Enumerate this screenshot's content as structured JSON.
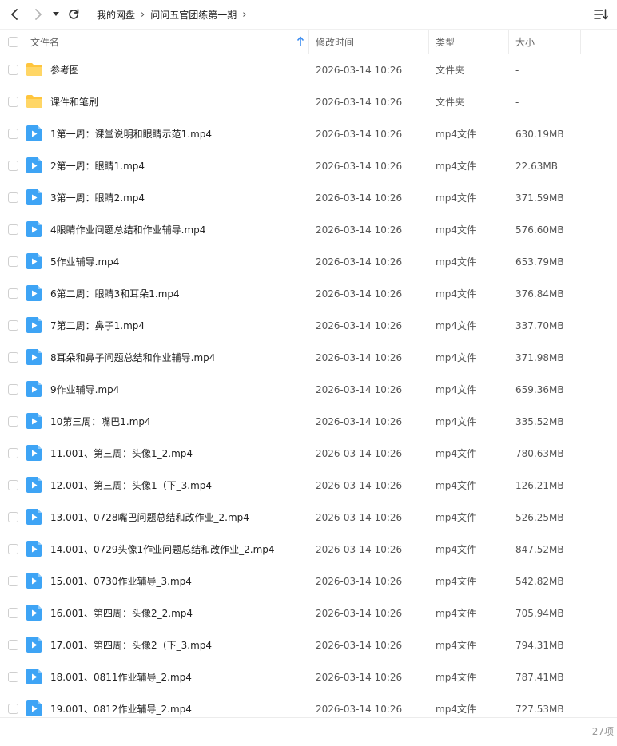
{
  "breadcrumbs": [
    "我的网盘",
    "问问五官团练第一期"
  ],
  "header": {
    "name": "文件名",
    "modified": "修改时间",
    "type": "类型",
    "size": "大小"
  },
  "footer": {
    "count": "27项"
  },
  "colors": {
    "folder": "#ffc53d",
    "video": "#3ea4f5",
    "accent": "#3b8cf0"
  },
  "files": [
    {
      "icon": "folder",
      "name": "参考图",
      "modified": "2026-03-14 10:26",
      "type": "文件夹",
      "size": "-"
    },
    {
      "icon": "folder",
      "name": "课件和笔刷",
      "modified": "2026-03-14 10:26",
      "type": "文件夹",
      "size": "-"
    },
    {
      "icon": "video",
      "name": "1第一周：课堂说明和眼睛示范1.mp4",
      "modified": "2026-03-14 10:26",
      "type": "mp4文件",
      "size": "630.19MB"
    },
    {
      "icon": "video",
      "name": "2第一周：眼睛1.mp4",
      "modified": "2026-03-14 10:26",
      "type": "mp4文件",
      "size": "22.63MB"
    },
    {
      "icon": "video",
      "name": "3第一周：眼睛2.mp4",
      "modified": "2026-03-14 10:26",
      "type": "mp4文件",
      "size": "371.59MB"
    },
    {
      "icon": "video",
      "name": "4眼睛作业问题总结和作业辅导.mp4",
      "modified": "2026-03-14 10:26",
      "type": "mp4文件",
      "size": "576.60MB"
    },
    {
      "icon": "video",
      "name": "5作业辅导.mp4",
      "modified": "2026-03-14 10:26",
      "type": "mp4文件",
      "size": "653.79MB"
    },
    {
      "icon": "video",
      "name": "6第二周：眼睛3和耳朵1.mp4",
      "modified": "2026-03-14 10:26",
      "type": "mp4文件",
      "size": "376.84MB"
    },
    {
      "icon": "video",
      "name": "7第二周：鼻子1.mp4",
      "modified": "2026-03-14 10:26",
      "type": "mp4文件",
      "size": "337.70MB"
    },
    {
      "icon": "video",
      "name": "8耳朵和鼻子问题总结和作业辅导.mp4",
      "modified": "2026-03-14 10:26",
      "type": "mp4文件",
      "size": "371.98MB"
    },
    {
      "icon": "video",
      "name": "9作业辅导.mp4",
      "modified": "2026-03-14 10:26",
      "type": "mp4文件",
      "size": "659.36MB"
    },
    {
      "icon": "video",
      "name": "10第三周：嘴巴1.mp4",
      "modified": "2026-03-14 10:26",
      "type": "mp4文件",
      "size": "335.52MB"
    },
    {
      "icon": "video",
      "name": "11.001、第三周：头像1_2.mp4",
      "modified": "2026-03-14 10:26",
      "type": "mp4文件",
      "size": "780.63MB"
    },
    {
      "icon": "video",
      "name": "12.001、第三周：头像1（下_3.mp4",
      "modified": "2026-03-14 10:26",
      "type": "mp4文件",
      "size": "126.21MB"
    },
    {
      "icon": "video",
      "name": "13.001、0728嘴巴问题总结和改作业_2.mp4",
      "modified": "2026-03-14 10:26",
      "type": "mp4文件",
      "size": "526.25MB"
    },
    {
      "icon": "video",
      "name": "14.001、0729头像1作业问题总结和改作业_2.mp4",
      "modified": "2026-03-14 10:26",
      "type": "mp4文件",
      "size": "847.52MB"
    },
    {
      "icon": "video",
      "name": "15.001、0730作业辅导_3.mp4",
      "modified": "2026-03-14 10:26",
      "type": "mp4文件",
      "size": "542.82MB"
    },
    {
      "icon": "video",
      "name": "16.001、第四周：头像2_2.mp4",
      "modified": "2026-03-14 10:26",
      "type": "mp4文件",
      "size": "705.94MB"
    },
    {
      "icon": "video",
      "name": "17.001、第四周：头像2（下_3.mp4",
      "modified": "2026-03-14 10:26",
      "type": "mp4文件",
      "size": "794.31MB"
    },
    {
      "icon": "video",
      "name": "18.001、0811作业辅导_2.mp4",
      "modified": "2026-03-14 10:26",
      "type": "mp4文件",
      "size": "787.41MB"
    },
    {
      "icon": "video",
      "name": "19.001、0812作业辅导_2.mp4",
      "modified": "2026-03-14 10:26",
      "type": "mp4文件",
      "size": "727.53MB"
    }
  ]
}
